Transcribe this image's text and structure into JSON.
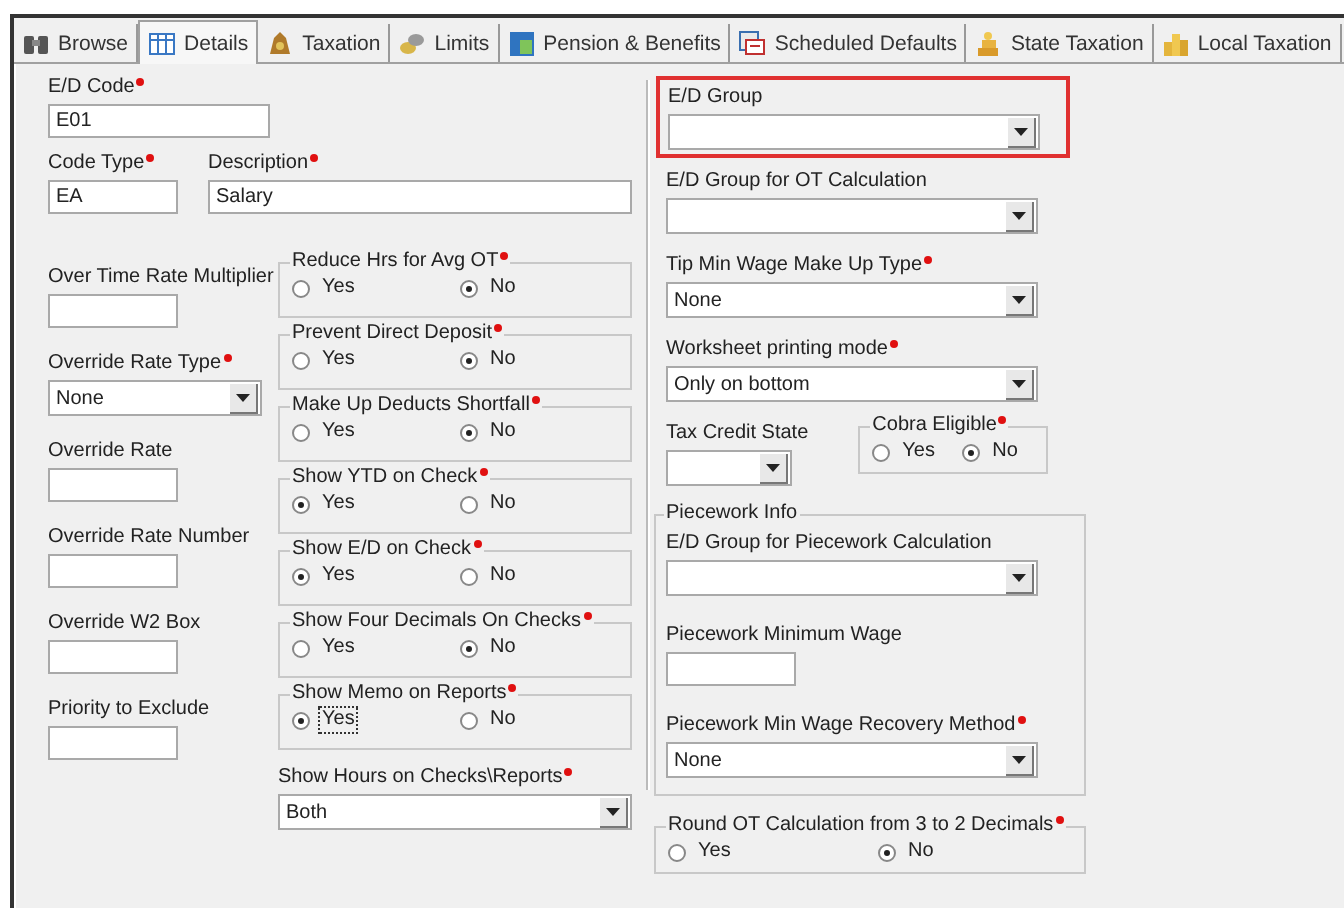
{
  "tabs": [
    {
      "label": "Browse",
      "selected": false
    },
    {
      "label": "Details",
      "selected": true
    },
    {
      "label": "Taxation",
      "selected": false
    },
    {
      "label": "Limits",
      "selected": false
    },
    {
      "label": "Pension & Benefits",
      "selected": false
    },
    {
      "label": "Scheduled Defaults",
      "selected": false
    },
    {
      "label": "State Taxation",
      "selected": false
    },
    {
      "label": "Local Taxation",
      "selected": false
    }
  ],
  "ed_code": {
    "label": "E/D Code",
    "required": true,
    "value": "E01"
  },
  "code_type": {
    "label": "Code Type",
    "required": true,
    "value": "EA"
  },
  "description": {
    "label": "Description",
    "required": true,
    "value": "Salary"
  },
  "left_fields": [
    {
      "label": "Over Time Rate Multiplier",
      "required": false,
      "kind": "text"
    },
    {
      "label": "Override Rate Type",
      "required": true,
      "kind": "dropdown",
      "value": "None"
    },
    {
      "label": "Override Rate",
      "required": false,
      "kind": "text"
    },
    {
      "label": "Override Rate Number",
      "required": false,
      "kind": "text"
    },
    {
      "label": "Override W2 Box",
      "required": false,
      "kind": "text"
    },
    {
      "label": "Priority to Exclude",
      "required": false,
      "kind": "text"
    }
  ],
  "radio_groups": [
    {
      "label": "Reduce Hrs for Avg OT",
      "required": true,
      "options": [
        {
          "label": "Yes",
          "selected": false,
          "focused": false
        },
        {
          "label": "No",
          "selected": true,
          "focused": false
        }
      ]
    },
    {
      "label": "Prevent Direct Deposit",
      "required": true,
      "options": [
        {
          "label": "Yes",
          "selected": false,
          "focused": false
        },
        {
          "label": "No",
          "selected": true,
          "focused": false
        }
      ]
    },
    {
      "label": "Make Up Deducts Shortfall",
      "required": true,
      "options": [
        {
          "label": "Yes",
          "selected": false,
          "focused": false
        },
        {
          "label": "No",
          "selected": true,
          "focused": false
        }
      ]
    },
    {
      "label": "Show YTD on Check",
      "required": true,
      "options": [
        {
          "label": "Yes",
          "selected": true,
          "focused": false
        },
        {
          "label": "No",
          "selected": false,
          "focused": false
        }
      ]
    },
    {
      "label": "Show E/D on Check",
      "required": true,
      "options": [
        {
          "label": "Yes",
          "selected": true,
          "focused": false
        },
        {
          "label": "No",
          "selected": false,
          "focused": false
        }
      ]
    },
    {
      "label": "Show Four Decimals On Checks",
      "required": true,
      "options": [
        {
          "label": "Yes",
          "selected": false,
          "focused": false
        },
        {
          "label": "No",
          "selected": true,
          "focused": false
        }
      ]
    },
    {
      "label": "Show Memo on Reports",
      "required": true,
      "options": [
        {
          "label": "Yes",
          "selected": true,
          "focused": true
        },
        {
          "label": "No",
          "selected": false,
          "focused": false
        }
      ]
    }
  ],
  "show_hours": {
    "label": "Show Hours on Checks\\Reports",
    "required": true,
    "value": "Both"
  },
  "right_fields": [
    {
      "label": "E/D Group",
      "required": false,
      "highlighted": true
    },
    {
      "label": "E/D Group for OT Calculation",
      "required": false,
      "highlighted": false
    },
    {
      "label": "Tip Min Wage Make Up Type",
      "required": true,
      "highlighted": false,
      "value": "None"
    },
    {
      "label": "Worksheet printing mode",
      "required": true,
      "highlighted": false,
      "value": "Only on bottom"
    }
  ],
  "tax_credit_state": {
    "label": "Tax Credit State",
    "required": false
  },
  "cobra": {
    "label": "Cobra Eligible",
    "required": true,
    "options": [
      {
        "label": "Yes",
        "selected": false,
        "focused": false
      },
      {
        "label": "No",
        "selected": true,
        "focused": false
      }
    ]
  },
  "piecework": {
    "title": "Piecework Info",
    "fields": [
      {
        "label": "E/D Group for Piecework Calculation",
        "required": false,
        "kind": "dropdown"
      },
      {
        "label": "Piecework Minimum Wage",
        "required": false,
        "kind": "text"
      },
      {
        "label": "Piecework Min Wage Recovery Method",
        "required": true,
        "kind": "dropdown",
        "value": "None"
      }
    ]
  },
  "round_ot": {
    "label": "Round OT Calculation from 3 to 2 Decimals",
    "required": true,
    "options": [
      {
        "label": "Yes",
        "selected": false,
        "focused": false
      },
      {
        "label": "No",
        "selected": true,
        "focused": false
      }
    ]
  }
}
